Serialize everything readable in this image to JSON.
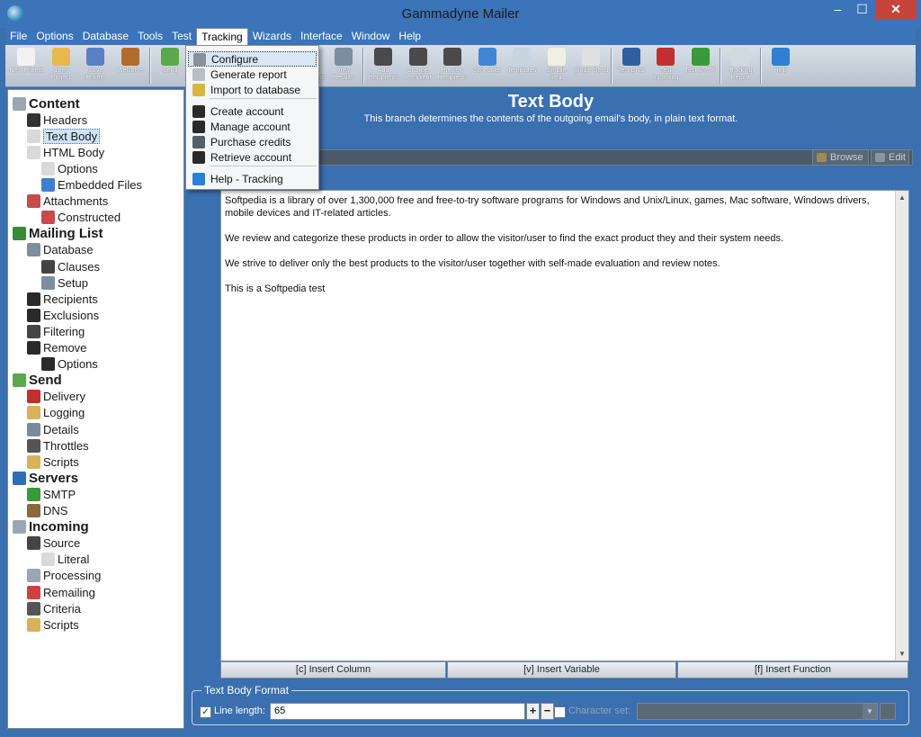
{
  "window": {
    "title": "Gammadyne Mailer",
    "minimize": "–",
    "maximize": "☐",
    "close": "✕"
  },
  "menubar": [
    "File",
    "Options",
    "Database",
    "Tools",
    "Test",
    "Tracking",
    "Wizards",
    "Interface",
    "Window",
    "Help"
  ],
  "toolbar": [
    {
      "label": "New Project",
      "icon": "new-project-icon",
      "color": "#f2f2f2"
    },
    {
      "label": "Open Project",
      "icon": "open-folder-icon",
      "color": "#e8b84a"
    },
    {
      "label": "Save Project",
      "icon": "save-disk-icon",
      "color": "#5a7fc4"
    },
    {
      "label": "Welcome",
      "icon": "door-icon",
      "color": "#b36b2a"
    },
    {
      "label": "Send",
      "icon": "send-icon",
      "color": "#5aa84a"
    },
    {
      "label": "",
      "icon": "hidden-icon",
      "color": "#6b7b8b"
    },
    {
      "label": "",
      "icon": "hidden-icon",
      "color": "#6b7b8b"
    },
    {
      "label": "",
      "icon": "hidden-icon",
      "color": "#6b7b8b"
    },
    {
      "label": "Send Attachments",
      "icon": "attachments-icon",
      "color": "#7a8a9a"
    },
    {
      "label": "View Results",
      "icon": "view-results-icon",
      "color": "#7d8da0"
    },
    {
      "label": "Add Recipients",
      "icon": "add-recipients-icon",
      "color": "#4a4a4a"
    },
    {
      "label": "Change Recipient",
      "icon": "change-recipient-icon",
      "color": "#4a4a4a"
    },
    {
      "label": "Preview Recipients",
      "icon": "preview-recipients-icon",
      "color": "#4a4a4a"
    },
    {
      "label": "Scheduler",
      "icon": "alarm-clock-icon",
      "color": "#3f86d6"
    },
    {
      "label": "Templates",
      "icon": "templates-icon",
      "color": "#c8d4e0"
    },
    {
      "label": "Simple Send",
      "icon": "simple-send-icon",
      "color": "#f0f0e0"
    },
    {
      "label": "Single Send",
      "icon": "single-send-icon",
      "color": "#e0e0e0"
    },
    {
      "label": "Test DNS",
      "icon": "test-dns-icon",
      "color": "#2f5fa0"
    },
    {
      "label": "Test Incoming",
      "icon": "test-incoming-icon",
      "color": "#c03030"
    },
    {
      "label": "Test SMTP",
      "icon": "test-smtp-icon",
      "color": "#3a9a3a"
    },
    {
      "label": "Tracking Report",
      "icon": "tracking-report-icon",
      "color": "#d0d8e0"
    },
    {
      "label": "Help",
      "icon": "help-icon",
      "color": "#2e7fd6"
    }
  ],
  "tracking_menu": [
    {
      "label": "Configure",
      "icon": "configure-icon",
      "color": "#8a9099",
      "highlight": true
    },
    {
      "label": "Generate report",
      "icon": "generate-report-icon",
      "color": "#b8bec6"
    },
    {
      "label": "Import to database",
      "icon": "import-database-icon",
      "color": "#d6b640"
    },
    {
      "label": "Create account",
      "icon": "create-account-icon",
      "color": "#2a2a2a"
    },
    {
      "label": "Manage account",
      "icon": "manage-account-icon",
      "color": "#2a2a2a"
    },
    {
      "label": "Purchase credits",
      "icon": "purchase-cart-icon",
      "color": "#555f69"
    },
    {
      "label": "Retrieve account",
      "icon": "retrieve-account-icon",
      "color": "#2a2a2a"
    },
    {
      "label": "Help - Tracking",
      "icon": "help-icon",
      "color": "#2e7fd6"
    }
  ],
  "tree": [
    {
      "label": "Content",
      "level": 0,
      "cat": true,
      "icon": "content-icon",
      "color": "#9aa6b2"
    },
    {
      "label": "Headers",
      "level": 1,
      "icon": "headers-icon",
      "color": "#333"
    },
    {
      "label": "Text Body",
      "level": 1,
      "icon": "text-body-icon",
      "color": "#d9d9d9",
      "selected": true
    },
    {
      "label": "HTML Body",
      "level": 1,
      "icon": "html-body-icon",
      "color": "#d9d9d9"
    },
    {
      "label": "Options",
      "level": 2,
      "icon": "options-icon",
      "color": "#d9d9d9"
    },
    {
      "label": "Embedded Files",
      "level": 2,
      "icon": "embedded-files-icon",
      "color": "#3f7fd0"
    },
    {
      "label": "Attachments",
      "level": 1,
      "icon": "attachments-icon",
      "color": "#c84a4a"
    },
    {
      "label": "Constructed",
      "level": 2,
      "icon": "constructed-icon",
      "color": "#c84a4a"
    },
    {
      "label": "Mailing List",
      "level": 0,
      "cat": true,
      "icon": "mailing-list-icon",
      "color": "#3a8a3a"
    },
    {
      "label": "Database",
      "level": 1,
      "icon": "database-icon",
      "color": "#7f8e9c"
    },
    {
      "label": "Clauses",
      "level": 2,
      "icon": "clauses-icon",
      "color": "#444"
    },
    {
      "label": "Setup",
      "level": 2,
      "icon": "setup-icon",
      "color": "#7f8e9c"
    },
    {
      "label": "Recipients",
      "level": 1,
      "icon": "recipients-icon",
      "color": "#2a2a2a"
    },
    {
      "label": "Exclusions",
      "level": 1,
      "icon": "exclusions-icon",
      "color": "#2a2a2a"
    },
    {
      "label": "Filtering",
      "level": 1,
      "icon": "filtering-icon",
      "color": "#444"
    },
    {
      "label": "Remove",
      "level": 1,
      "icon": "remove-icon",
      "color": "#2a2a2a"
    },
    {
      "label": "Options",
      "level": 2,
      "icon": "options-icon",
      "color": "#2a2a2a"
    },
    {
      "label": "Send",
      "level": 0,
      "cat": true,
      "icon": "send-icon",
      "color": "#5aa84a"
    },
    {
      "label": "Delivery",
      "level": 1,
      "icon": "delivery-truck-icon",
      "color": "#c03030"
    },
    {
      "label": "Logging",
      "level": 1,
      "icon": "logging-icon",
      "color": "#d8b25a"
    },
    {
      "label": "Details",
      "level": 1,
      "icon": "details-icon",
      "color": "#7a8a9a"
    },
    {
      "label": "Throttles",
      "level": 1,
      "icon": "calendar-icon",
      "color": "#555"
    },
    {
      "label": "Scripts",
      "level": 1,
      "icon": "scripts-icon",
      "color": "#d8b25a"
    },
    {
      "label": "Servers",
      "level": 0,
      "cat": true,
      "icon": "servers-icon",
      "color": "#2c6fb4"
    },
    {
      "label": "SMTP",
      "level": 1,
      "icon": "smtp-icon",
      "color": "#3a9a3a"
    },
    {
      "label": "DNS",
      "level": 1,
      "icon": "dns-icon",
      "color": "#8a6a3a"
    },
    {
      "label": "Incoming",
      "level": 0,
      "cat": true,
      "icon": "incoming-icon",
      "color": "#9aa6b2"
    },
    {
      "label": "Source",
      "level": 1,
      "icon": "source-icon",
      "color": "#444"
    },
    {
      "label": "Literal",
      "level": 2,
      "icon": "literal-icon",
      "color": "#d9d9d9"
    },
    {
      "label": "Processing",
      "level": 1,
      "icon": "processing-icon",
      "color": "#9aa6b2"
    },
    {
      "label": "Remailing",
      "level": 1,
      "icon": "remailing-icon",
      "color": "#d04040"
    },
    {
      "label": "Criteria",
      "level": 1,
      "icon": "criteria-icon",
      "color": "#555"
    },
    {
      "label": "Scripts",
      "level": 1,
      "icon": "scripts-icon",
      "color": "#d8b25a"
    }
  ],
  "main": {
    "title": "Text Body",
    "description": "This branch determines the contents of the outgoing email's body, in plain text format.",
    "browse_label": "Browse",
    "edit_label": "Edit",
    "body_paragraphs": [
      "Softpedia is a library of over 1,300,000 free and free-to-try software programs for Windows and Unix/Linux, games, Mac software, Windows drivers, mobile devices and IT-related articles.",
      "We review and categorize these products in order to allow the visitor/user to find the exact product they and their system needs.",
      "We strive to deliver only the best products to the visitor/user together with self-made evaluation and review notes.",
      "This is a Softpedia test"
    ],
    "insert_column": "[c] Insert Column",
    "insert_variable": "[v] Insert Variable",
    "insert_function": "[f] Insert Function",
    "format": {
      "legend": "Text Body Format",
      "line_length_label": "Line length:",
      "line_length_checked": true,
      "line_length_value": "65",
      "plus": "+",
      "minus": "−",
      "charset_label": "Character set:",
      "charset_checked": false
    }
  }
}
